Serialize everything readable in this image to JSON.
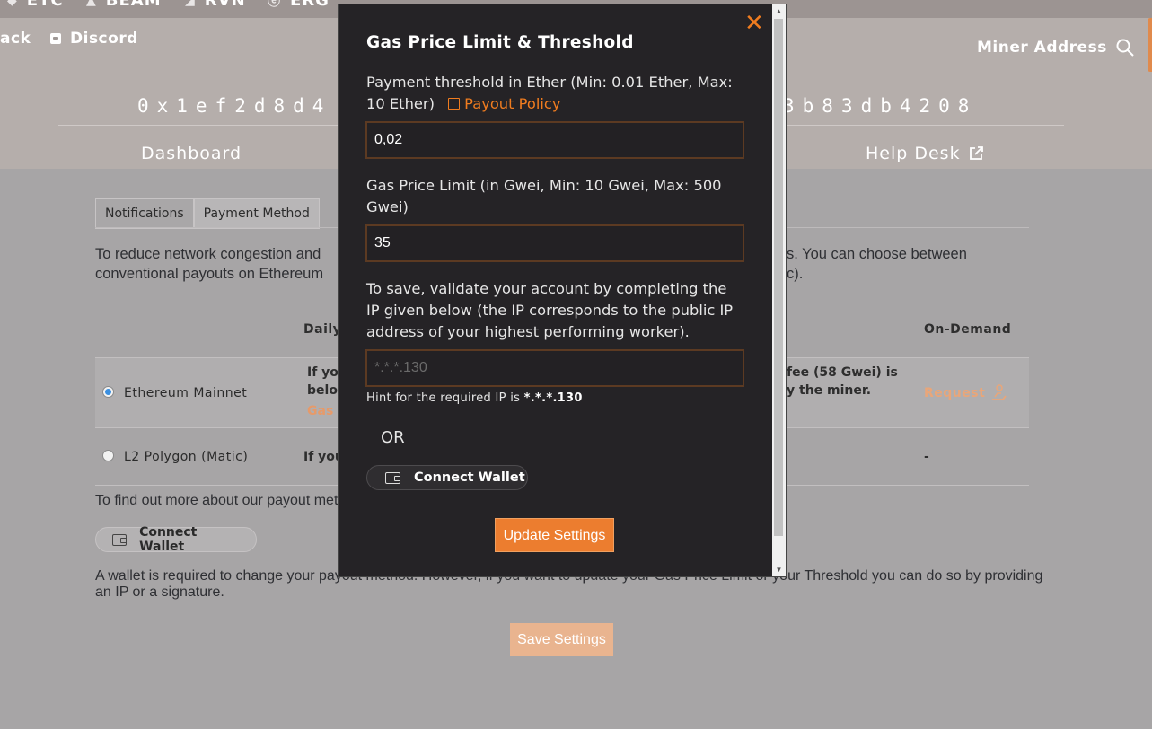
{
  "topbar": {
    "coins": [
      {
        "label": "ETC",
        "icon": "etc-icon"
      },
      {
        "label": "BEAM",
        "icon": "beam-icon"
      },
      {
        "label": "RVN",
        "icon": "rvn-icon"
      },
      {
        "label": "ERG",
        "icon": "erg-icon"
      }
    ]
  },
  "header": {
    "nav_left_partial": "ack",
    "discord": "Discord",
    "miner_address": "Miner Address",
    "wallet_left": "0x1ef2d8d4",
    "wallet_right": "3b83db4208",
    "tab_dashboard": "Dashboard",
    "tab_helpdesk": "Help Desk"
  },
  "settings": {
    "tabs": [
      "Notifications",
      "Payment Method"
    ],
    "intro_line1_left": "To reduce network congestion and",
    "intro_line1_right": "s. You can choose between",
    "intro_line2_left": "conventional payouts on Ethereum",
    "intro_line2_right": "c).",
    "col_daily": "Daily",
    "col_ondemand": "On-Demand",
    "rows": [
      {
        "label": "Ethereum Mainnet",
        "desc1": "If yo",
        "desc2": "belo",
        "desc3": "Gas",
        "right1": "fee (58 Gwei) is",
        "right2": "y the miner.",
        "ondemand": "Request"
      },
      {
        "label": "L2 Polygon (Matic)",
        "desc1": "If you",
        "ondemand": "-"
      }
    ],
    "find_out": "To find out more about our payout met",
    "connect_wallet": "Connect Wallet",
    "footer_note_line1": "A wallet is required to change your payout method. However, if you want to update your Gas Price Limit or your Threshold you can do so by providing",
    "footer_note_line2": "an IP or a signature.",
    "save_settings": "Save Settings"
  },
  "modal": {
    "title": "Gas Price Limit & Threshold",
    "close": "✕",
    "threshold_label": "Payment threshold in Ether (Min: 0.01 Ether, Max: 10 Ether)",
    "payout_policy_link": "Payout Policy",
    "threshold_value": "0,02",
    "gas_label": "Gas Price Limit (in Gwei, Min: 10 Gwei, Max: 500 Gwei)",
    "gas_value": "35",
    "ip_label": "To save, validate your account by completing the IP given below (the IP corresponds to the public IP address of your highest performing worker).",
    "ip_placeholder": "*.*.*.130",
    "hint_prefix": "Hint for the required IP is",
    "hint_value": "*.*.*.130",
    "or": "OR",
    "connect_wallet": "Connect Wallet",
    "update_settings": "Update Settings"
  },
  "colors": {
    "accent": "#f07c1f",
    "modal_bg": "#252326",
    "overlay_bg": "#a7a5a6"
  }
}
